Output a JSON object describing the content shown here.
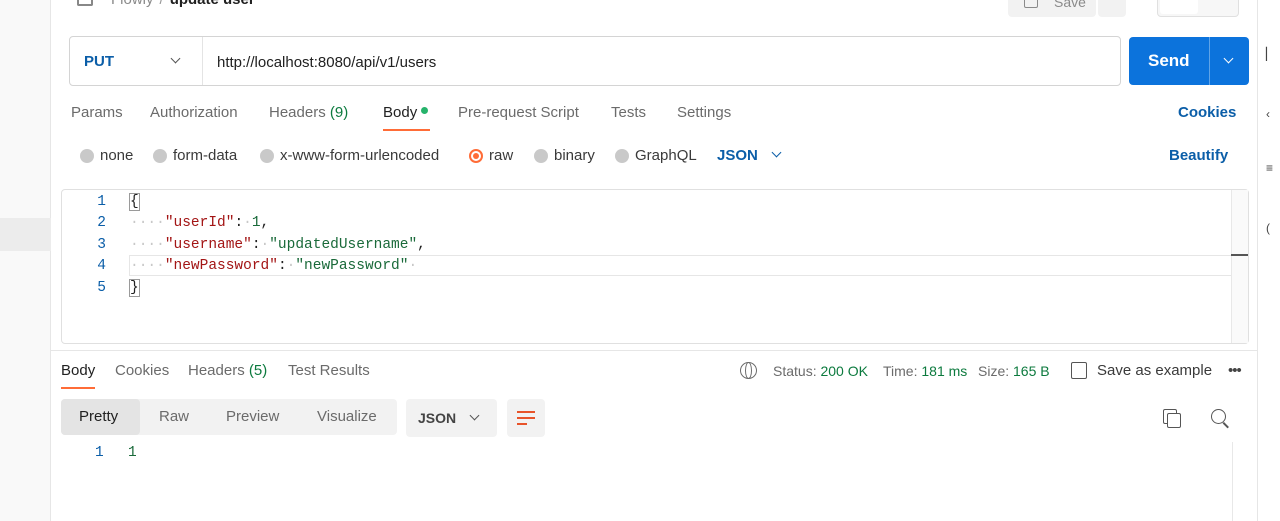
{
  "breadcrumb": {
    "parent": "Flowly",
    "separator": "/",
    "current": "update user"
  },
  "toolbar": {
    "save_label": "Save"
  },
  "request": {
    "method": "PUT",
    "url": "http://localhost:8080/api/v1/users",
    "send_label": "Send"
  },
  "tabs": {
    "params": "Params",
    "authorization": "Authorization",
    "headers": "Headers",
    "headers_count": "(9)",
    "body": "Body",
    "prerequest": "Pre-request Script",
    "tests": "Tests",
    "settings": "Settings",
    "cookies": "Cookies"
  },
  "body_types": {
    "none": "none",
    "form_data": "form-data",
    "urlencoded": "x-www-form-urlencoded",
    "raw": "raw",
    "binary": "binary",
    "graphql": "GraphQL",
    "selected": "raw",
    "language": "JSON",
    "beautify": "Beautify"
  },
  "editor": {
    "line_numbers": [
      "1",
      "2",
      "3",
      "4",
      "5"
    ],
    "open_brace": "{",
    "close_brace": "}",
    "k1": "\"userId\"",
    "v1": "1",
    "k2": "\"username\"",
    "v2": "\"updatedUsername\"",
    "k3": "\"newPassword\"",
    "v3": "\"newPassword\""
  },
  "response": {
    "tabs": {
      "body": "Body",
      "cookies": "Cookies",
      "headers": "Headers",
      "headers_count": "(5)",
      "test_results": "Test Results"
    },
    "status_label": "Status:",
    "status_value": "200 OK",
    "time_label": "Time:",
    "time_value": "181 ms",
    "size_label": "Size:",
    "size_value": "165 B",
    "save_example": "Save as example",
    "more": "•••",
    "views": {
      "pretty": "Pretty",
      "raw": "Raw",
      "preview": "Preview",
      "visualize": "Visualize"
    },
    "format": "JSON",
    "line_number": "1",
    "value": "1"
  },
  "colors": {
    "accent": "#ff6c37",
    "primary": "#0c73dc",
    "link": "#0b5ea8",
    "success": "#0c7a3e"
  }
}
